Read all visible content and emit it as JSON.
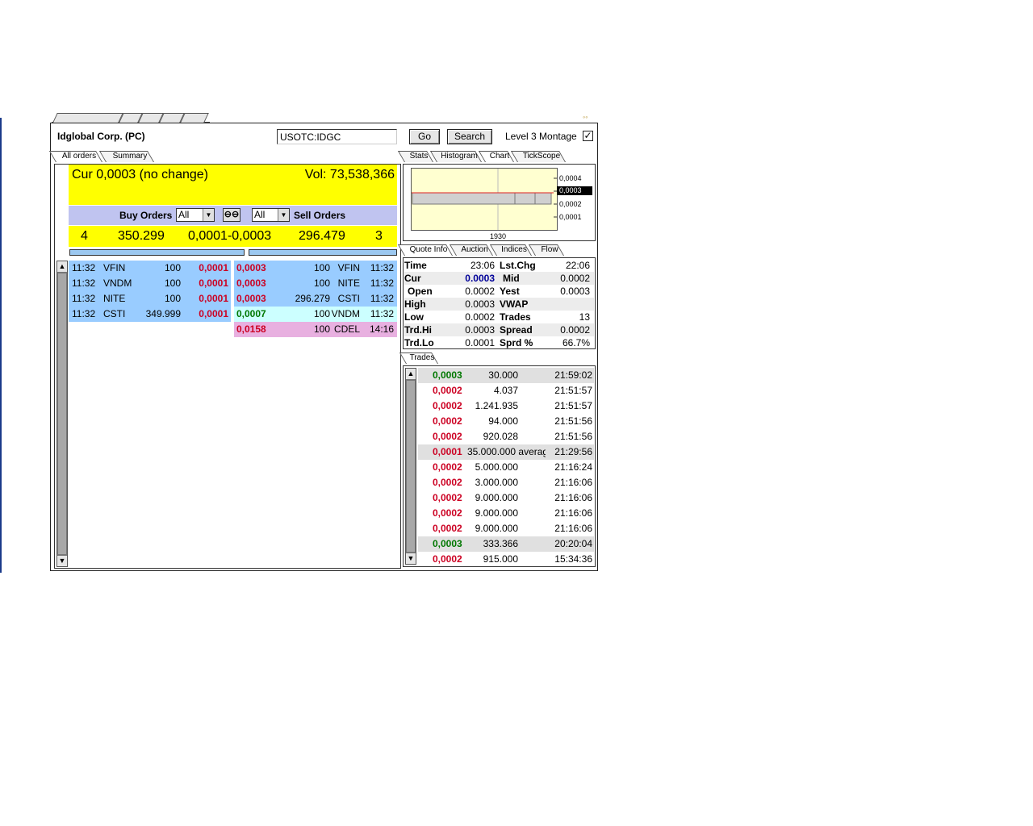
{
  "header": {
    "company": "Idglobal Corp. (PC)",
    "symbol_value": "USOTC:IDGC",
    "go_label": "Go",
    "search_label": "Search",
    "montage_label": "Level 3 Montage",
    "montage_checked": "✓"
  },
  "left_tabs": [
    "All orders",
    "Summary"
  ],
  "current": {
    "cur_text": "Cur 0,0003 (no change)",
    "vol_text": "Vol: 73,538,366"
  },
  "orders_header": {
    "buy_label": "Buy Orders",
    "sell_label": "Sell Orders",
    "buy_filter": "All",
    "sell_filter": "All",
    "link_icon": "link-icon"
  },
  "summary": {
    "buy_count": "4",
    "buy_volume": "350.299",
    "spread": "0,0001-0,0003",
    "sell_volume": "296.479",
    "sell_count": "3"
  },
  "buy_orders": [
    {
      "time": "11:32",
      "mm": "VFIN",
      "size": "100",
      "price": "0,0001"
    },
    {
      "time": "11:32",
      "mm": "VNDM",
      "size": "100",
      "price": "0,0001"
    },
    {
      "time": "11:32",
      "mm": "NITE",
      "size": "100",
      "price": "0,0001"
    },
    {
      "time": "11:32",
      "mm": "CSTI",
      "size": "349.999",
      "price": "0,0001"
    }
  ],
  "sell_orders": [
    {
      "price": "0,0003",
      "size": "100",
      "mm": "VFIN",
      "time": "11:32",
      "color": "#99ccff"
    },
    {
      "price": "0,0003",
      "size": "100",
      "mm": "NITE",
      "time": "11:32",
      "color": "#99ccff"
    },
    {
      "price": "0,0003",
      "size": "296.279",
      "mm": "CSTI",
      "time": "11:32",
      "color": "#99ccff"
    },
    {
      "price": "0,0007",
      "size": "100",
      "mm": "VNDM",
      "time": "11:32",
      "color": "#ccffff"
    },
    {
      "price": "0,0158",
      "size": "100",
      "mm": "CDEL",
      "time": "14:16",
      "color": "#e8b0e0"
    }
  ],
  "right_tabs": [
    "Stats",
    "Histogram",
    "Chart",
    "TickScope"
  ],
  "chart_data": {
    "type": "line",
    "x_tick": "1930",
    "y_ticks": [
      "0,0004",
      "0,0003",
      "0,0002",
      "0,0001"
    ],
    "current_marker": "0,0003",
    "current_value": 0.0003,
    "y_range": [
      0.0001,
      0.0004
    ]
  },
  "quote_tabs": [
    "Quote Info",
    "Auction",
    "Indices",
    "Flow"
  ],
  "quote": [
    {
      "l1": "Time",
      "v1": "23:06",
      "l2": "Lst.Chg",
      "v2": "22:06"
    },
    {
      "l1": "Cur",
      "v1": "0.0003",
      "l2": "Mid",
      "v2": "0.0002"
    },
    {
      "l1": "Open",
      "v1": "0.0002",
      "l2": "Yest",
      "v2": "0.0003"
    },
    {
      "l1": "High",
      "v1": "0.0003",
      "l2": "VWAP",
      "v2": ""
    },
    {
      "l1": "Low",
      "v1": "0.0002",
      "l2": "Trades",
      "v2": "13"
    },
    {
      "l1": "Trd.Hi",
      "v1": "0.0003",
      "l2": "Spread",
      "v2": "0.0002"
    },
    {
      "l1": "Trd.Lo",
      "v1": "0.0001",
      "l2": "Sprd %",
      "v2": "66.7%"
    }
  ],
  "trades_tab": "Trades",
  "trades": [
    {
      "price": "0,0003",
      "volume": "30.000",
      "time": "21:59:02",
      "color": "green",
      "shade": true
    },
    {
      "price": "0,0002",
      "volume": "4.037",
      "time": "21:51:57",
      "color": "red",
      "shade": false
    },
    {
      "price": "0,0002",
      "volume": "1.241.935",
      "time": "21:51:57",
      "color": "red",
      "shade": false
    },
    {
      "price": "0,0002",
      "volume": "94.000",
      "time": "21:51:56",
      "color": "red",
      "shade": false
    },
    {
      "price": "0,0002",
      "volume": "920.028",
      "time": "21:51:56",
      "color": "red",
      "shade": false
    },
    {
      "price": "0,0001",
      "volume": "35.000.000 averag",
      "time": "21:29:56",
      "color": "red",
      "shade": true
    },
    {
      "price": "0,0002",
      "volume": "5.000.000",
      "time": "21:16:24",
      "color": "red",
      "shade": false
    },
    {
      "price": "0,0002",
      "volume": "3.000.000",
      "time": "21:16:06",
      "color": "red",
      "shade": false
    },
    {
      "price": "0,0002",
      "volume": "9.000.000",
      "time": "21:16:06",
      "color": "red",
      "shade": false
    },
    {
      "price": "0,0002",
      "volume": "9.000.000",
      "time": "21:16:06",
      "color": "red",
      "shade": false
    },
    {
      "price": "0,0002",
      "volume": "9.000.000",
      "time": "21:16:06",
      "color": "red",
      "shade": false
    },
    {
      "price": "0,0003",
      "volume": "333.366",
      "time": "20:20:04",
      "color": "green",
      "shade": true
    },
    {
      "price": "0,0002",
      "volume": "915.000",
      "time": "15:34:36",
      "color": "red",
      "shade": false
    }
  ]
}
